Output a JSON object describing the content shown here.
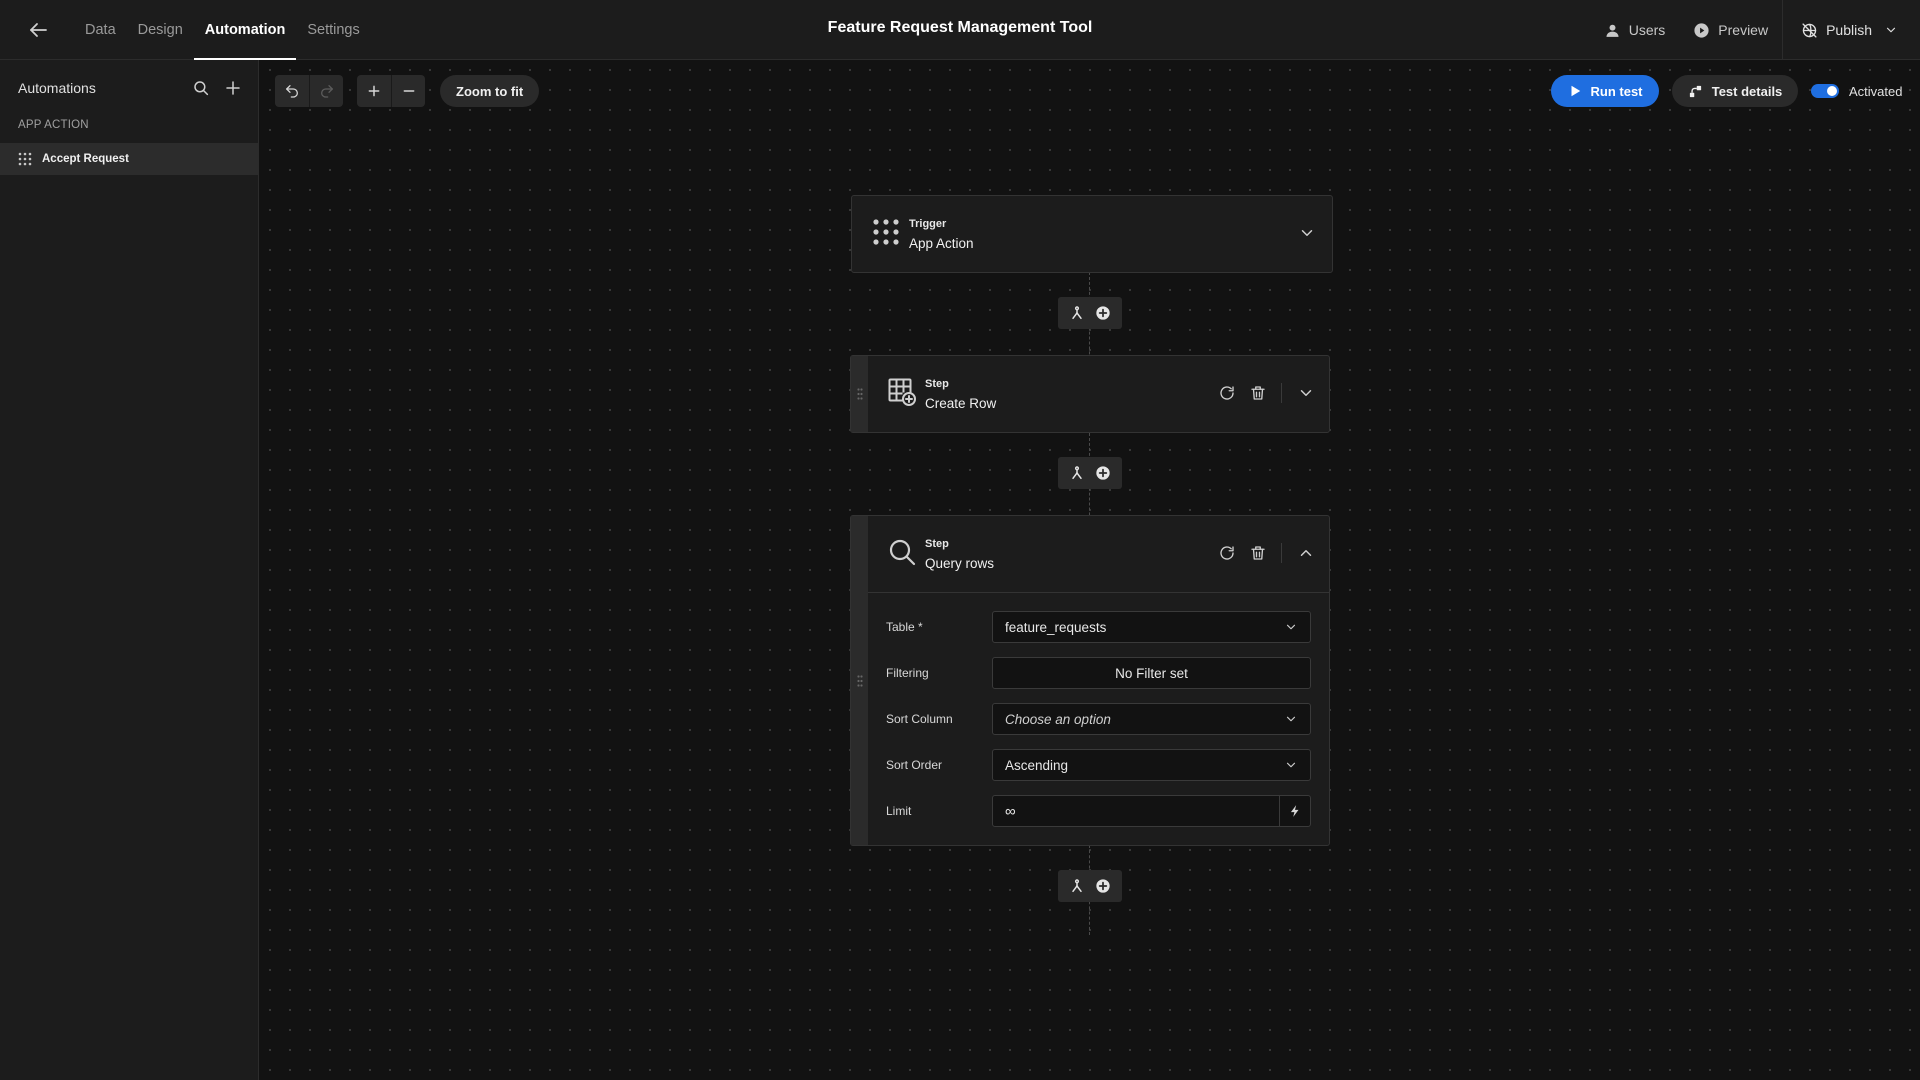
{
  "topbar": {
    "title": "Feature Request Management Tool",
    "tabs": [
      {
        "label": "Data"
      },
      {
        "label": "Design"
      },
      {
        "label": "Automation",
        "active": true
      },
      {
        "label": "Settings"
      }
    ],
    "users_label": "Users",
    "preview_label": "Preview",
    "publish_label": "Publish"
  },
  "sidebar": {
    "title": "Automations",
    "section_label": "APP ACTION",
    "items": [
      {
        "label": "Accept Request",
        "selected": true
      }
    ]
  },
  "toolbar": {
    "zoom_to_fit_label": "Zoom to fit",
    "run_test_label": "Run test",
    "test_details_label": "Test details",
    "activated_label": "Activated",
    "activated": true
  },
  "flow": {
    "trigger": {
      "kicker": "Trigger",
      "title": "App Action",
      "icon": "app-action-grid-icon"
    },
    "steps": [
      {
        "kicker": "Step",
        "title": "Create Row",
        "icon": "create-row-icon",
        "expanded": false
      },
      {
        "kicker": "Step",
        "title": "Query rows",
        "icon": "magnifier-icon",
        "expanded": true,
        "fields": {
          "table": {
            "label": "Table *",
            "value": "feature_requests"
          },
          "filtering": {
            "label": "Filtering",
            "value": "No Filter set"
          },
          "sort_column": {
            "label": "Sort Column",
            "placeholder": "Choose an option"
          },
          "sort_order": {
            "label": "Sort Order",
            "value": "Ascending"
          },
          "limit": {
            "label": "Limit",
            "value": "∞"
          }
        }
      }
    ]
  },
  "colors": {
    "accent": "#1f6ee0",
    "background": "#121212",
    "panel": "#1c1c1c"
  }
}
